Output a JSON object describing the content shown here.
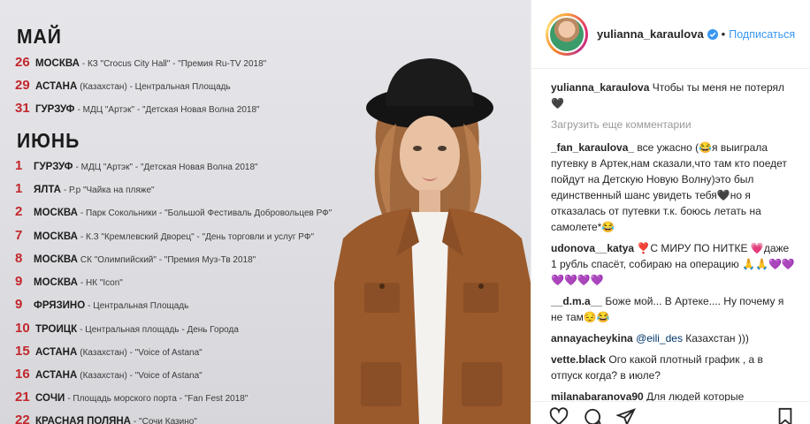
{
  "poster": {
    "months": [
      {
        "name": "МАЙ",
        "events": [
          {
            "day": "26",
            "city": "МОСКВА",
            "venue": "- КЗ \"Crocus City Hall\" - \"Премия Ru-TV 2018\""
          },
          {
            "day": "29",
            "city": "АСТАНА",
            "venue": "(Казахстан) - Центральная Площадь"
          },
          {
            "day": "31",
            "city": "ГУРЗУФ",
            "venue": "- МДЦ \"Артэк\" - \"Детская Новая Волна 2018\""
          }
        ]
      },
      {
        "name": "ИЮНЬ",
        "events": [
          {
            "day": "1",
            "city": "ГУРЗУФ",
            "venue": "- МДЦ \"Артэк\" - \"Детская Новая Волна 2018\""
          },
          {
            "day": "1",
            "city": "ЯЛТА",
            "venue": "- Р.р \"Чайка на пляже\""
          },
          {
            "day": "2",
            "city": "МОСКВА",
            "venue": "- Парк Сокольники - \"Большой Фестиваль Добровольцев РФ\""
          },
          {
            "day": "7",
            "city": "МОСКВА",
            "venue": "- К.З \"Кремлевский Дворец\" - \"День торговли и услуг РФ\""
          },
          {
            "day": "8",
            "city": "МОСКВА",
            "venue": "СК \"Олимпийский\" - \"Премия Муз-Тв 2018\""
          },
          {
            "day": "9",
            "city": "МОСКВА",
            "venue": "- НК \"Icon\""
          },
          {
            "day": "9",
            "city": "ФРЯЗИНО",
            "venue": "- Центральная Площадь"
          },
          {
            "day": "10",
            "city": "ТРОИЦК",
            "venue": "- Центральная площадь - День Города"
          },
          {
            "day": "15",
            "city": "АСТАНА",
            "venue": "(Казахстан) - \"Voice of Astana\""
          },
          {
            "day": "16",
            "city": "АСТАНА",
            "venue": "(Казахстан) - \"Voice of Astana\""
          },
          {
            "day": "21",
            "city": "СОЧИ",
            "venue": "- Площадь морского порта - \"Fan Fest 2018\""
          },
          {
            "day": "22",
            "city": "КРАСНАЯ ПОЛЯНА",
            "venue": "- \"Сочи Казино\""
          }
        ]
      }
    ]
  },
  "header": {
    "username": "yulianna_karaulova",
    "separator": "•",
    "follow_label": "Подписаться"
  },
  "caption": {
    "username": "yulianna_karaulova",
    "text": " Чтобы ты меня не потерял 🖤"
  },
  "load_more_label": "Загрузить еще комментарии",
  "comments": [
    {
      "username": "_fan_karaulova_",
      "text": " все ужасно (😂я выиграла путевку в Артек,нам сказали,что там кто поедет пойдут на Детскую Новую Волну)это был единственный шанс увидеть тебя🖤но я отказалась от путевки т.к. боюсь летать на самолете*😂"
    },
    {
      "username": "udonova__katya",
      "text": " ❣️С МИРУ ПО НИТКЕ 💗даже 1 рубль спасёт, собираю на операцию 🙏🙏💜💜💜💜💜💜"
    },
    {
      "username": "__d.m.a__",
      "text": " Боже мой... В Артеке.... Ну почему я не там😔😂"
    },
    {
      "username": "annayacheykina",
      "mention": "@eili_des",
      "text": " Казахстан )))"
    },
    {
      "username": "vette.black",
      "text": " Ого какой плотный график , а в отпуск когда? в июле?"
    },
    {
      "username": "milanabaranova90",
      "text": " Для людей которые"
    }
  ],
  "colors": {
    "day_red": "#c2272d",
    "follow_blue": "#3897f0",
    "verified_blue": "#3897f0"
  },
  "icons": [
    "verified-badge-icon",
    "heart-icon",
    "comment-icon",
    "share-icon",
    "bookmark-icon"
  ]
}
